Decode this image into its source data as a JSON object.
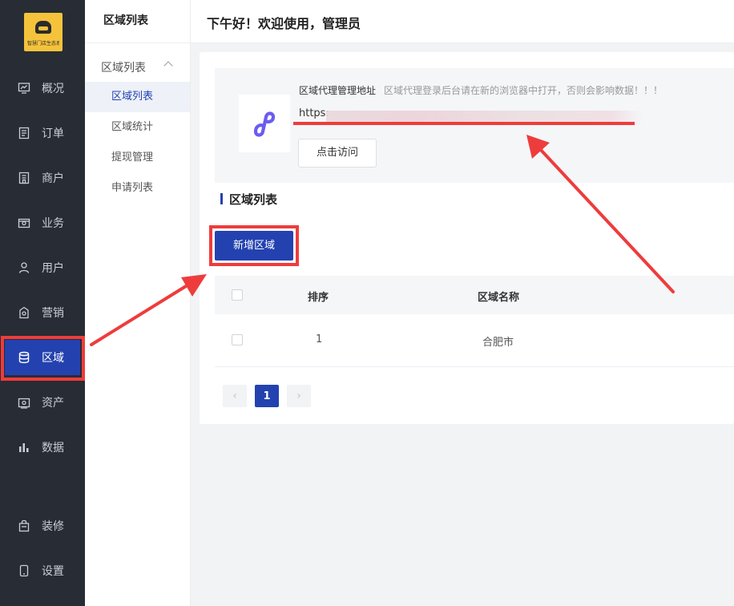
{
  "colors": {
    "rail_bg": "#282c34",
    "accent": "#2342b0",
    "highlight": "#ee3c3c",
    "logo_bg": "#f5c33b"
  },
  "brand": {
    "logo_text": "智慧门店生态系统"
  },
  "rail": {
    "items": [
      {
        "label": "概况",
        "icon": "monitor-chart-icon"
      },
      {
        "label": "订单",
        "icon": "document-icon"
      },
      {
        "label": "商户",
        "icon": "building-icon"
      },
      {
        "label": "业务",
        "icon": "briefcase-icon"
      },
      {
        "label": "用户",
        "icon": "user-icon"
      },
      {
        "label": "营销",
        "icon": "tag-icon"
      },
      {
        "label": "区域",
        "icon": "database-icon",
        "active": true
      },
      {
        "label": "资产",
        "icon": "wallet-icon"
      },
      {
        "label": "数据",
        "icon": "bar-chart-icon"
      },
      {
        "label": "装修",
        "icon": "bag-icon"
      },
      {
        "label": "设置",
        "icon": "phone-icon"
      }
    ]
  },
  "submenu": {
    "title": "区域列表",
    "group": "区域列表",
    "items": [
      {
        "label": "区域列表",
        "active": true
      },
      {
        "label": "区域统计"
      },
      {
        "label": "提现管理"
      },
      {
        "label": "申请列表"
      }
    ]
  },
  "header": {
    "greeting": "下午好！欢迎使用，管理员"
  },
  "agent": {
    "label": "区域代理管理地址",
    "tip": "区域代理登录后台请在新的浏览器中打开，否则会影响数据！！！",
    "url_prefix": "https:",
    "visit_button": "点击访问"
  },
  "section": {
    "title": "区域列表"
  },
  "toolbar": {
    "add_button": "新增区域"
  },
  "table": {
    "columns": [
      "排序",
      "区域名称"
    ],
    "rows": [
      {
        "sort": "1",
        "name": "合肥市"
      }
    ]
  },
  "pagination": {
    "current": "1",
    "prev": "‹",
    "next": "›"
  }
}
